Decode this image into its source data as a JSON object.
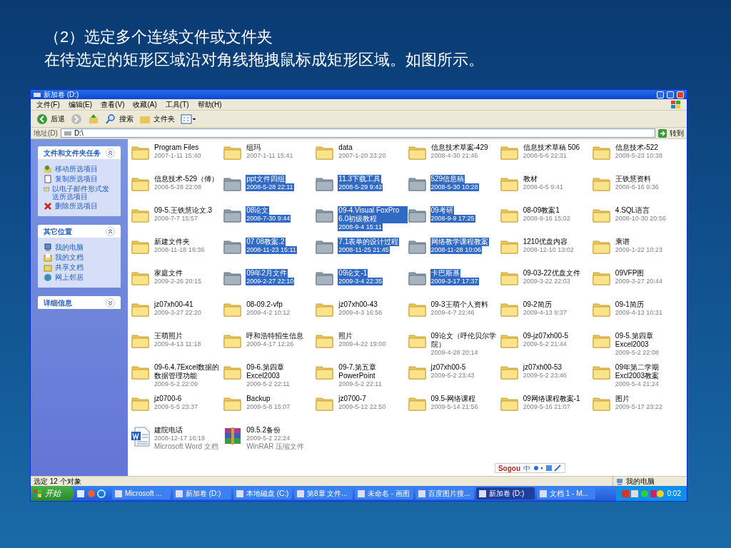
{
  "heading": [
    "（2）选定多个连续文件或文件夹",
    "在待选定的矩形区域沿对角线拖拽鼠标成矩形区域。如图所示。"
  ],
  "window": {
    "title": "新加卷 (D:)"
  },
  "menu": [
    "文件(F)",
    "编辑(E)",
    "查看(V)",
    "收藏(A)",
    "工具(T)",
    "帮助(H)"
  ],
  "toolbar": {
    "back": "后退",
    "search": "搜索",
    "folders": "文件夹"
  },
  "address": {
    "label": "地址(D)",
    "value": "D:\\",
    "go": "转到"
  },
  "sidebar": [
    {
      "title": "文件和文件夹任务",
      "expanded": true,
      "items": [
        {
          "kind": "move",
          "label": "移动所选项目"
        },
        {
          "kind": "copy",
          "label": "复制所选项目"
        },
        {
          "kind": "email",
          "label": "以电子邮件形式发送所选项目"
        },
        {
          "kind": "delete",
          "label": "删除所选项目"
        }
      ]
    },
    {
      "title": "其它位置",
      "expanded": true,
      "items": [
        {
          "kind": "computer",
          "label": "我的电脑"
        },
        {
          "kind": "documents",
          "label": "我的文档"
        },
        {
          "kind": "shared",
          "label": "共享文档"
        },
        {
          "kind": "network",
          "label": "网上邻居"
        }
      ]
    },
    {
      "title": "详细信息",
      "expanded": false
    }
  ],
  "files": [
    {
      "kind": "folder",
      "name": "Program Files",
      "date": "2007-1-11 15:40",
      "selected": false
    },
    {
      "kind": "folder",
      "name": "组玛",
      "date": "2007-1-11 15:41",
      "selected": false
    },
    {
      "kind": "folder",
      "name": "data",
      "date": "2007-1-20 23:20",
      "selected": false
    },
    {
      "kind": "folder",
      "name": "信息技术草案-429",
      "date": "2008-4-30 21:46",
      "selected": false
    },
    {
      "kind": "folder",
      "name": "信息技术草稿 506",
      "date": "2008-5-6 22:31",
      "selected": false
    },
    {
      "kind": "folder",
      "name": "信息技术-522",
      "date": "2008-5-23 10:38",
      "selected": false
    },
    {
      "kind": "folder",
      "name": "信息技术-529（傅）",
      "date": "2008-5-28 22:08",
      "selected": false
    },
    {
      "kind": "folder",
      "name": "ppt文件四组",
      "date": "2008-5-28 22:11",
      "selected": true
    },
    {
      "kind": "folder",
      "name": "11.3下载工具",
      "date": "2008-5-29 9:42",
      "selected": true
    },
    {
      "kind": "folder",
      "name": "529信息稿",
      "date": "2008-5-30 10:28",
      "selected": true
    },
    {
      "kind": "folder",
      "name": "教材",
      "date": "2008-6-5 9:41",
      "selected": false
    },
    {
      "kind": "folder",
      "name": "王铁慧资料",
      "date": "2008-6-16 9:36",
      "selected": false
    },
    {
      "kind": "folder",
      "name": "09-5.王铁慧论文.3",
      "date": "2008-7-7 15:57",
      "selected": false
    },
    {
      "kind": "folder",
      "name": "08论文",
      "date": "2008-7-30 9:44",
      "selected": true
    },
    {
      "kind": "folder",
      "name": "09-4.Visual FoxPro 6.0初级教程",
      "date": "2008-9-4 15:11",
      "selected": true
    },
    {
      "kind": "folder",
      "name": "09考研",
      "date": "2008-9-9 17:25",
      "selected": true
    },
    {
      "kind": "folder",
      "name": "08-09教案1",
      "date": "2008-9-16 15:02",
      "selected": false
    },
    {
      "kind": "folder",
      "name": "4.SQL语言",
      "date": "2008-10-30 20:56",
      "selected": false
    },
    {
      "kind": "folder",
      "name": "新建文件夹",
      "date": "2008-11-18 16:36",
      "selected": false
    },
    {
      "kind": "folder",
      "name": "07 08教案.2",
      "date": "2008-11-23 15:11",
      "selected": true
    },
    {
      "kind": "folder",
      "name": "7.1表单的设计过程",
      "date": "2008-11-25 21:45",
      "selected": true
    },
    {
      "kind": "folder",
      "name": "网络教学课程教案",
      "date": "2008-11-28 10:06",
      "selected": true
    },
    {
      "kind": "folder",
      "name": "1210优盘内容",
      "date": "2008-12-10 13:02",
      "selected": false
    },
    {
      "kind": "folder",
      "name": "乘谱",
      "date": "2009-1-22 10:23",
      "selected": false
    },
    {
      "kind": "folder",
      "name": "家庭文件",
      "date": "2009-2-26 20:15",
      "selected": false
    },
    {
      "kind": "folder",
      "name": "09年2月文件",
      "date": "2009-2-27 22:10",
      "selected": true
    },
    {
      "kind": "folder",
      "name": "09论文-1",
      "date": "2009-3-4 22:35",
      "selected": true
    },
    {
      "kind": "folder",
      "name": "卡巴斯基",
      "date": "2009-3-17 17:37",
      "selected": true
    },
    {
      "kind": "folder",
      "name": "09-03-22优盘文件",
      "date": "2009-3-22 22:03",
      "selected": false
    },
    {
      "kind": "folder",
      "name": "09VFP图",
      "date": "2009-3-27 20:44",
      "selected": false
    },
    {
      "kind": "folder",
      "name": "jz07xh00-41",
      "date": "2009-3-27 22:20",
      "selected": false
    },
    {
      "kind": "folder",
      "name": "08-09.2-vfp",
      "date": "2009-4-2 10:12",
      "selected": false
    },
    {
      "kind": "folder",
      "name": "jz07xh00-43",
      "date": "2009-4-3 16:56",
      "selected": false
    },
    {
      "kind": "folder",
      "name": "09-3王萌个人资料",
      "date": "2009-4-7 22:46",
      "selected": false
    },
    {
      "kind": "folder",
      "name": "09-2简历",
      "date": "2009-4-13 9:37",
      "selected": false
    },
    {
      "kind": "folder",
      "name": "09-1简历",
      "date": "2009-4-13 10:31",
      "selected": false
    },
    {
      "kind": "folder",
      "name": "王萌照片",
      "date": "2009-4-13 11:18",
      "selected": false
    },
    {
      "kind": "folder",
      "name": "呼和浩特招生信息",
      "date": "2009-4-17 12:26",
      "selected": false
    },
    {
      "kind": "folder",
      "name": "照片",
      "date": "2009-4-22 19:00",
      "selected": false
    },
    {
      "kind": "folder",
      "name": "09论文（呼伦贝尔学院）",
      "date": "2009-4-28 20:14",
      "selected": false
    },
    {
      "kind": "folder",
      "name": "09-jz07xh00-5",
      "date": "2009-5-2 21:44",
      "selected": false
    },
    {
      "kind": "folder",
      "name": "09-5.第四章 Excel2003",
      "date": "2009-5-2 22:08",
      "selected": false
    },
    {
      "kind": "folder",
      "name": "09-6.4.7Excel数据的数据管理功能",
      "date": "2009-5-2 22:09",
      "selected": false
    },
    {
      "kind": "folder",
      "name": "09-6.第四章 Excel2003",
      "date": "2009-5-2 22:11",
      "selected": false
    },
    {
      "kind": "folder",
      "name": "09-7.第五章 PowerPoint",
      "date": "2009-5-2 22:11",
      "selected": false
    },
    {
      "kind": "folder",
      "name": "jz07xh00-5",
      "date": "2009-5-2 23:43",
      "selected": false
    },
    {
      "kind": "folder",
      "name": "jz07xh00-53",
      "date": "2009-5-2 23:46",
      "selected": false
    },
    {
      "kind": "folder",
      "name": "09年第二学期 Excl2003教案",
      "date": "2009-5-4 21:24",
      "selected": false
    },
    {
      "kind": "folder",
      "name": "jz0700-6",
      "date": "2009-5-5 23:37",
      "selected": false
    },
    {
      "kind": "folder",
      "name": "Backup",
      "date": "2009-5-8 15:07",
      "selected": false
    },
    {
      "kind": "folder",
      "name": "jz0700-7",
      "date": "2009-5-12 22:50",
      "selected": false
    },
    {
      "kind": "folder",
      "name": "09.5-网络课程",
      "date": "2009-5-14 21:56",
      "selected": false
    },
    {
      "kind": "folder",
      "name": "09网络课程教案-1",
      "date": "2009-5-16 21:07",
      "selected": false
    },
    {
      "kind": "folder",
      "name": "图片",
      "date": "2009-5-17 23:22",
      "selected": false
    },
    {
      "kind": "word",
      "name": "建院电话",
      "date": "2008-12-17 16:19",
      "type": "Microsoft Word 文档",
      "selected": false
    },
    {
      "kind": "archive",
      "name": "09.5.2备份",
      "date": "2009-5-2 22:24",
      "type": "WinRAR 压缩文件",
      "selected": false
    }
  ],
  "ime_bar": {
    "logo": "Sogou",
    "mode": "中"
  },
  "status_bar": {
    "selection": "选定 12 个对象",
    "location": "我的电脑"
  },
  "taskbar": {
    "start": "开始",
    "tasks": [
      {
        "label": "Microsoft ...",
        "selected": false
      },
      {
        "label": "新加卷 (D:)",
        "selected": false
      },
      {
        "label": "本地磁盘 (C:)",
        "selected": false
      },
      {
        "label": "第8章 文件...",
        "selected": false
      },
      {
        "label": "未命名 - 画图",
        "selected": false
      },
      {
        "label": "百度图片搜...",
        "selected": false
      },
      {
        "label": "新加卷 (D:)",
        "selected": true
      },
      {
        "label": "文档 1 - M...",
        "selected": false
      }
    ],
    "clock": "0:02"
  }
}
